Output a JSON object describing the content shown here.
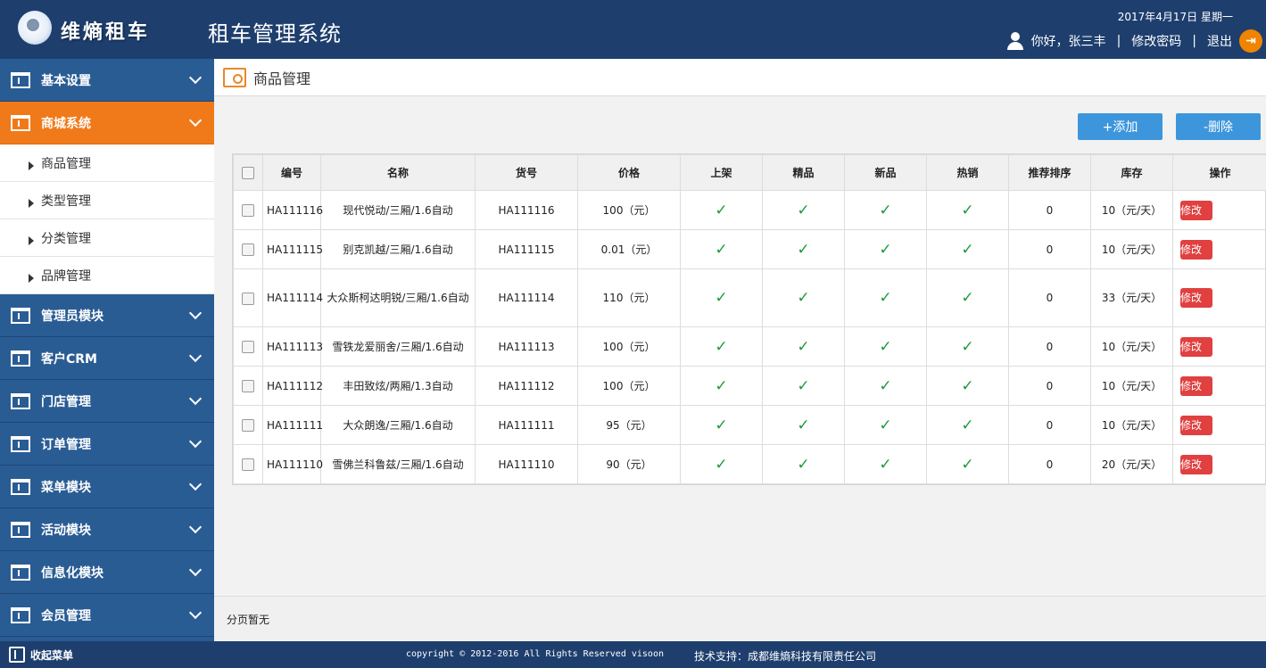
{
  "header": {
    "logo_text": "维熵租车",
    "system_title": "租车管理系统",
    "date": "2017年4月17日  星期一",
    "greeting": "你好，张三丰",
    "change_password": "修改密码",
    "logout": "退出"
  },
  "sidebar": {
    "menus": [
      {
        "label": "基本设置"
      },
      {
        "label": "商城系统",
        "active": true
      },
      {
        "label": "管理员模块"
      },
      {
        "label": "客户CRM"
      },
      {
        "label": "门店管理"
      },
      {
        "label": "订单管理"
      },
      {
        "label": "菜单模块"
      },
      {
        "label": "活动模块"
      },
      {
        "label": "信息化模块"
      },
      {
        "label": "会员管理"
      }
    ],
    "submenu": [
      "商品管理",
      "类型管理",
      "分类管理",
      "品牌管理"
    ]
  },
  "main": {
    "breadcrumb": "商品管理",
    "add_button": "+添加",
    "delete_button": "-删除",
    "columns": [
      "编号",
      "名称",
      "货号",
      "价格",
      "上架",
      "精品",
      "新品",
      "热销",
      "推荐排序",
      "库存",
      "操作"
    ],
    "rows": [
      {
        "id": "HA111116",
        "name": "现代悦动/三厢/1.6自动",
        "sku": "HA111116",
        "price": "100（元）",
        "rank": "0",
        "stock": "10（元/天）",
        "edit": "修改"
      },
      {
        "id": "HA111115",
        "name": "别克凯越/三厢/1.6自动",
        "sku": "HA111115",
        "price": "0.01（元）",
        "rank": "0",
        "stock": "10（元/天）",
        "edit": "修改"
      },
      {
        "id": "HA111114",
        "name": "大众斯柯达明锐/三厢/1.6自动",
        "sku": "HA111114",
        "price": "110（元）",
        "rank": "0",
        "stock": "33（元/天）",
        "edit": "修改"
      },
      {
        "id": "HA111113",
        "name": "雪铁龙爱丽舍/三厢/1.6自动",
        "sku": "HA111113",
        "price": "100（元）",
        "rank": "0",
        "stock": "10（元/天）",
        "edit": "修改"
      },
      {
        "id": "HA111112",
        "name": "丰田致炫/两厢/1.3自动",
        "sku": "HA111112",
        "price": "100（元）",
        "rank": "0",
        "stock": "10（元/天）",
        "edit": "修改"
      },
      {
        "id": "HA111111",
        "name": "大众朗逸/三厢/1.6自动",
        "sku": "HA111111",
        "price": "95（元）",
        "rank": "0",
        "stock": "10（元/天）",
        "edit": "修改"
      },
      {
        "id": "HA111110",
        "name": "雪佛兰科鲁兹/三厢/1.6自动",
        "sku": "HA111110",
        "price": "90（元）",
        "rank": "0",
        "stock": "20（元/天）",
        "edit": "修改"
      }
    ],
    "check_mark": "✓",
    "pager_text": "分页暂无"
  },
  "footer": {
    "collapse_menu": "收起菜单",
    "copyright": "copyright © 2012-2016 All Rights Reserved visoon",
    "support": "技术支持：成都维熵科技有限责任公司"
  },
  "colors": {
    "header_bg": "#1e3f6e",
    "sidebar_bg": "#2a5c94",
    "active_menu": "#f07a1a",
    "button_blue": "#3d96dc",
    "edit_red": "#e04040",
    "check_green": "#1e9a3a"
  }
}
